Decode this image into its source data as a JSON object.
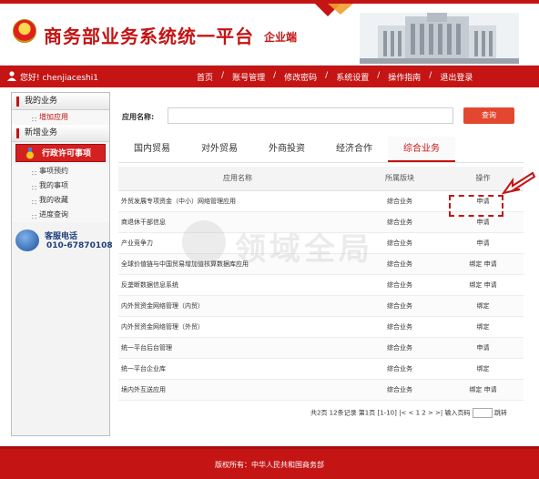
{
  "header": {
    "title": "商务部业务系统统一平台",
    "subtitle": "企业端"
  },
  "navbar": {
    "greeting": "您好! chenjiaceshi1",
    "menu": [
      "首页",
      "账号管理",
      "修改密码",
      "系统设置",
      "操作指南",
      "退出登录"
    ]
  },
  "sidebar": {
    "my_business": "我的业务",
    "add_app": "增加应用",
    "new_business": "新增业务",
    "active_item": "行政许可事项",
    "items": [
      "事项预约",
      "我的事项",
      "我的收藏",
      "进度查询"
    ],
    "hotline_label": "客服电话",
    "hotline_number": "010-67870108"
  },
  "search": {
    "label": "应用名称:",
    "placeholder": "",
    "button": "查询"
  },
  "tabs": [
    "国内贸易",
    "对外贸易",
    "外商投资",
    "经济合作",
    "综合业务"
  ],
  "active_tab": "综合业务",
  "table": {
    "headers": [
      "应用名称",
      "所属版块",
      "操作"
    ],
    "rows": [
      {
        "name": "外贸发展专项资金（中小）网络管理应用",
        "module": "综合业务",
        "ops": "申请"
      },
      {
        "name": "商退休干部信息",
        "module": "综合业务",
        "ops": "申请"
      },
      {
        "name": "产业竞争力",
        "module": "综合业务",
        "ops": "申请"
      },
      {
        "name": "全球价值链与中国贸易增加值核算数据库应用",
        "module": "综合业务",
        "ops": "绑定 申请"
      },
      {
        "name": "反垄断数据信息系统",
        "module": "综合业务",
        "ops": "绑定 申请"
      },
      {
        "name": "内外贸资金网络管理（内贸）",
        "module": "综合业务",
        "ops": "绑定"
      },
      {
        "name": "内外贸资金网络管理（外贸）",
        "module": "综合业务",
        "ops": "绑定"
      },
      {
        "name": "统一平台后台管理",
        "module": "综合业务",
        "ops": "申请"
      },
      {
        "name": "统一平台企业库",
        "module": "综合业务",
        "ops": "绑定"
      },
      {
        "name": "境内外互送应用",
        "module": "综合业务",
        "ops": "绑定 申请"
      }
    ]
  },
  "pager": {
    "summary": "共2页 12条记录 第1页 [1-10] |< < 1 2 > >| 输入页码",
    "go": "跳转"
  },
  "watermark": "领域全局",
  "footer": "版权所有：中华人民共和国商务部",
  "colors": {
    "brand_red": "#c41414",
    "button_red": "#e4472f"
  }
}
